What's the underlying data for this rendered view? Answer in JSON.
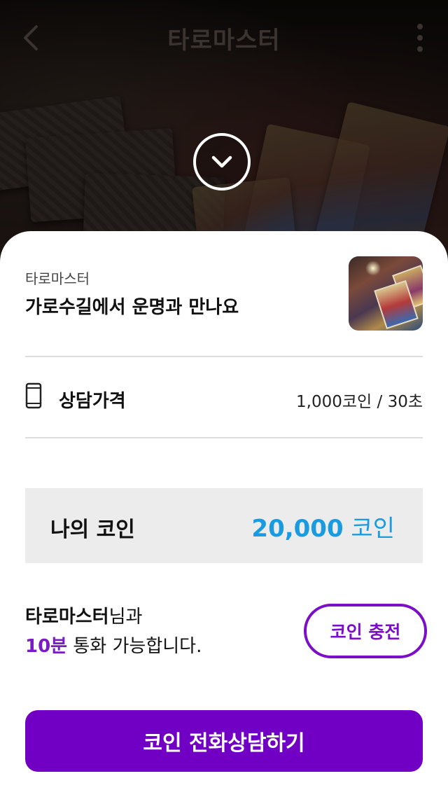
{
  "header": {
    "title": "타로마스터",
    "back_icon": "chevron-left-icon",
    "more_icon": "more-vertical-icon"
  },
  "collapse_icon": "chevron-down-icon",
  "provider": {
    "subtitle": "타로마스터",
    "title": "가로수길에서 운명과 만나요"
  },
  "price": {
    "icon": "phone-icon",
    "label": "상담가격",
    "value": "1,000코인 / 30초"
  },
  "my_coin": {
    "label": "나의 코인",
    "amount": "20,000",
    "unit": " 코인"
  },
  "talk_info": {
    "name": "타로마스터",
    "suffix": "님과",
    "minutes": "10분",
    "rest": " 통화 가능합니다."
  },
  "charge_button": "코인 충전",
  "consult_button": "코인 전화상담하기",
  "colors": {
    "accent_purple": "#7100c4",
    "coin_blue": "#1a9be0"
  }
}
